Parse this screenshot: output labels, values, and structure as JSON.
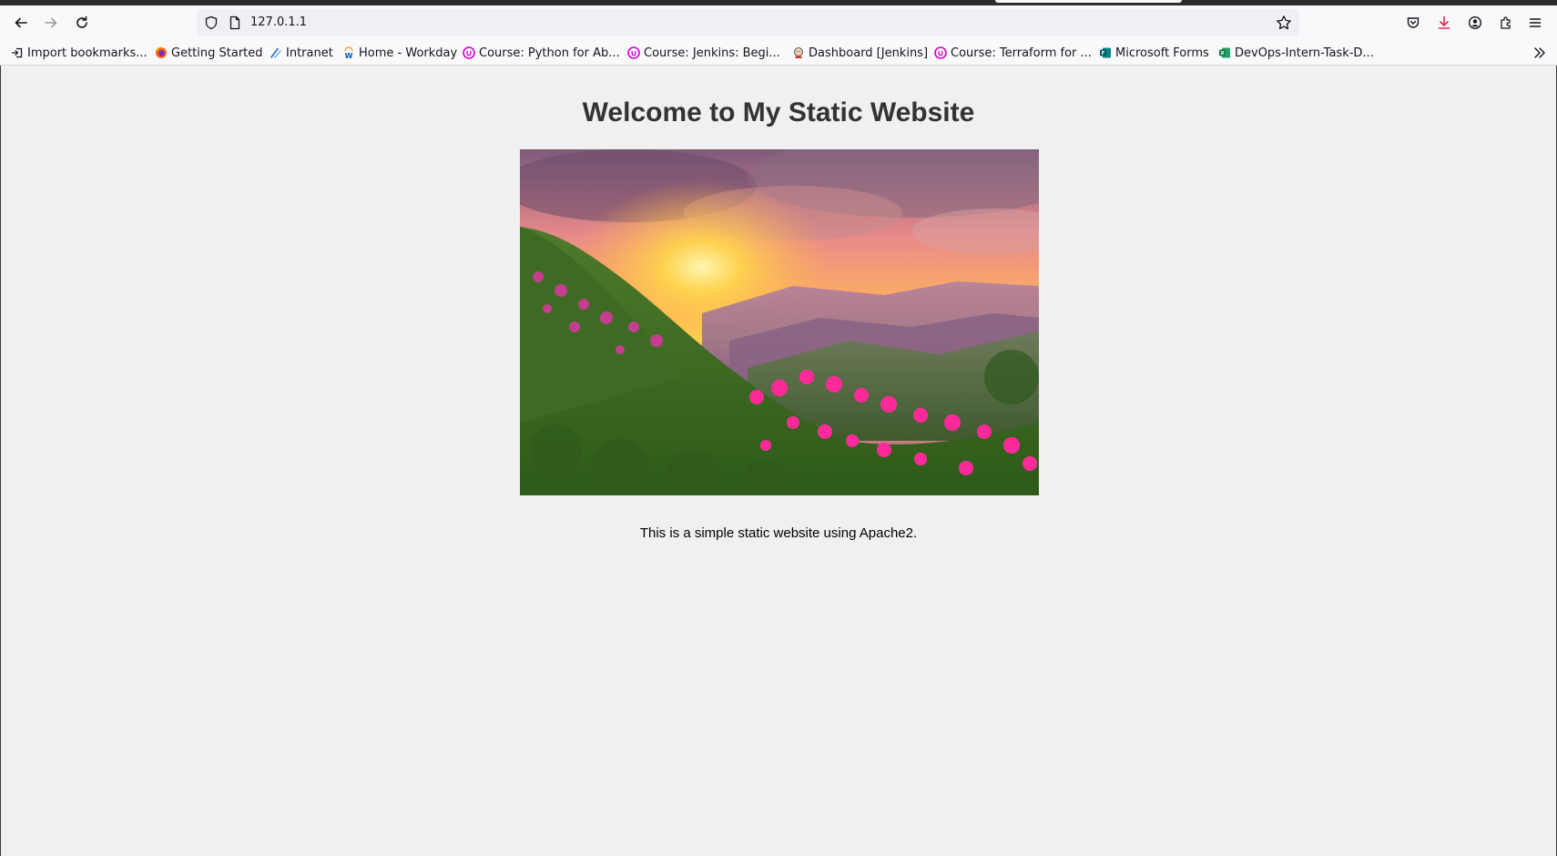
{
  "browser": {
    "url": "127.0.1.1",
    "bookmarks": [
      {
        "label": "Import bookmarks...",
        "icon": "import-icon"
      },
      {
        "label": "Getting Started",
        "icon": "firefox-icon"
      },
      {
        "label": "Intranet",
        "icon": "intranet-icon"
      },
      {
        "label": "Home - Workday",
        "icon": "workday-icon"
      },
      {
        "label": "Course: Python for Ab...",
        "icon": "udemy-icon"
      },
      {
        "label": "Course: Jenkins: Begi...",
        "icon": "udemy-icon"
      },
      {
        "label": "Dashboard [Jenkins]",
        "icon": "jenkins-icon"
      },
      {
        "label": "Course: Terraform for ...",
        "icon": "udemy-icon"
      },
      {
        "label": "Microsoft Forms",
        "icon": "forms-icon"
      },
      {
        "label": "DevOps-Intern-Task-D...",
        "icon": "excel-icon"
      }
    ]
  },
  "page": {
    "title": "Welcome to My Static Website",
    "caption": "This is a simple static website using Apache2."
  },
  "colors": {
    "page_bg": "#f0f0f0",
    "title_color": "#333333",
    "udemy_purple": "#d100d1",
    "download_red": "#e22850"
  }
}
